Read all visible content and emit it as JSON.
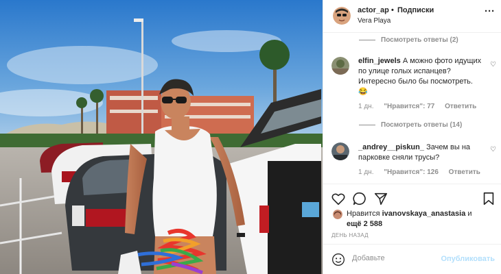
{
  "post": {
    "username": "actor_ap",
    "dot": "•",
    "follow": "Подписки",
    "location": "Vera Playa"
  },
  "comments": [
    {
      "username": "elfin_jewels",
      "text": "А можно фото идущих по улице голых испанцев? Интересно было бы посмотреть.😂",
      "time": "1 дн.",
      "likes": "\"Нравится\": 77",
      "reply": "Ответить",
      "view_replies": "Посмотреть ответы (14)"
    },
    {
      "username": "_andrey__piskun_",
      "text": "Зачем вы на парковке сняли трусы?",
      "time": "1 дн.",
      "likes": "\"Нравится\": 126",
      "reply": "Ответить"
    }
  ],
  "top_view_replies": "Посмотреть ответы (2)",
  "likes_prefix": "Нравится",
  "likes_user": "ivanovskaya_anastasia",
  "likes_and": "и",
  "likes_more": "ещё 2 588",
  "date": "ДЕНЬ НАЗАД",
  "add_comment": {
    "placeholder": "Добавьте",
    "publish": "Опубликовать"
  },
  "icons": {
    "more": "more-icon",
    "heart": "heart-icon",
    "comment": "comment-icon",
    "share": "share-icon",
    "bookmark": "bookmark-icon",
    "emoji": "emoji-icon"
  },
  "colors": {
    "link_disabled": "#b2dffc",
    "muted": "#8e8e8e",
    "text": "#262626",
    "sky": "#2f7fd1"
  }
}
